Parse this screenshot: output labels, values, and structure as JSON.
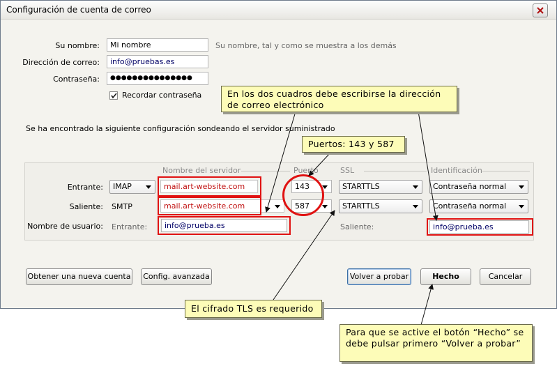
{
  "window": {
    "title": "Configuración de cuenta de correo"
  },
  "form": {
    "name_label": "Su nombre:",
    "name_value": "Mi nombre",
    "name_hint": "Su nombre, tal y como se muestra a los demás",
    "email_label": "Dirección de correo:",
    "email_value": "info@pruebas.es",
    "password_label": "Contraseña:",
    "password_value": "●●●●●●●●●●●●●●●",
    "remember_label": "Recordar contraseña",
    "remember_checked": true,
    "found_message": "Se ha encontrado la siguiente configuración sondeando el servidor suministrado"
  },
  "config": {
    "headers": {
      "server": "Nombre del servidor",
      "port": "Puerto",
      "ssl": "SSL",
      "auth": "Identificación"
    },
    "incoming": {
      "label": "Entrante:",
      "protocol": "IMAP",
      "server": "mail.art-website.com",
      "port": "143",
      "ssl": "STARTTLS",
      "auth": "Contraseña normal"
    },
    "outgoing": {
      "label": "Saliente:",
      "protocol": "SMTP",
      "server": "mail.art-website.com",
      "port": "587",
      "ssl": "STARTTLS",
      "auth": "Contraseña normal"
    },
    "username": {
      "label": "Nombre de usuario:",
      "incoming_label": "Entrante:",
      "incoming_value": "info@prueba.es",
      "outgoing_label": "Saliente:",
      "outgoing_value": "info@prueba.es"
    }
  },
  "buttons": {
    "new_account": "Obtener una nueva cuenta",
    "advanced": "Config. avanzada",
    "retest": "Volver a probar",
    "done": "Hecho",
    "cancel": "Cancelar"
  },
  "callouts": {
    "email_note": "En los dos cuadros debe escribirse la dirección de correo electrónico",
    "ports_note": "Puertos: 143 y 587",
    "tls_note": "El cifrado TLS es requerido",
    "done_note": "Para que se active el botón “Hecho” se debe pulsar primero “Volver a probar”"
  },
  "colors": {
    "annotation_red": "#e01212",
    "callout_bg": "#fdfcb8"
  }
}
